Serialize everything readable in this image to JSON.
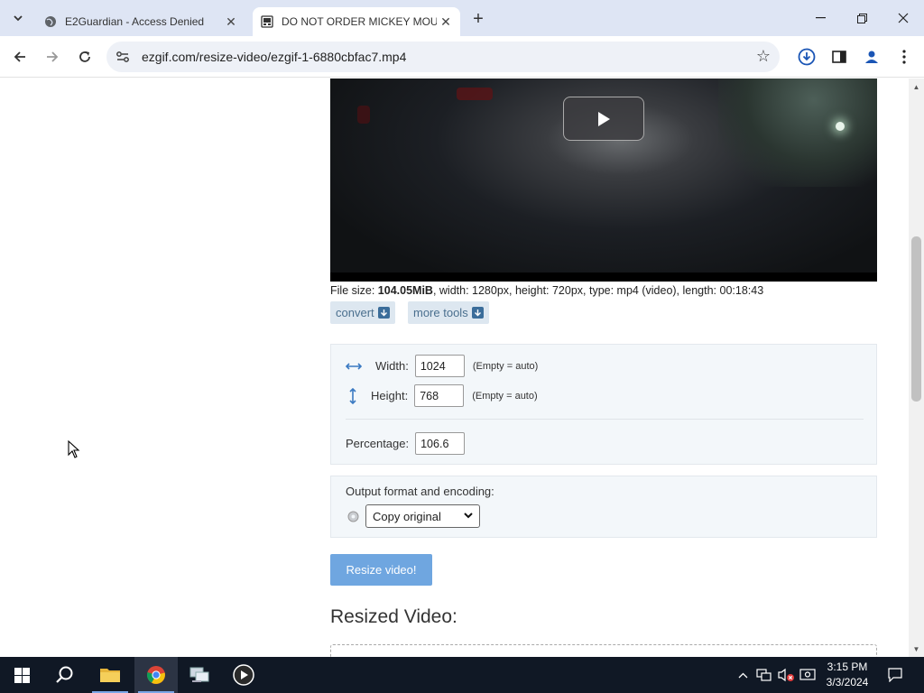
{
  "browser": {
    "tabs": [
      {
        "title": "E2Guardian - Access Denied",
        "active": false
      },
      {
        "title": "DO NOT ORDER MICKEY MOUS",
        "active": true
      }
    ],
    "url": "ezgif.com/resize-video/ezgif-1-6880cbfac7.mp4"
  },
  "video": {
    "file_size_label": "File size: ",
    "file_size": "104.05MiB",
    "details": ", width: 1280px, height: 720px, type: mp4 (video), length: 00:18:43"
  },
  "tools": {
    "convert": "convert",
    "more_tools": "more tools"
  },
  "resize": {
    "width_label": "Width:",
    "width_value": "1024",
    "height_label": "Height:",
    "height_value": "768",
    "empty_hint": "(Empty = auto)",
    "percentage_label": "Percentage:",
    "percentage_value": "106.6"
  },
  "output": {
    "label": "Output format and encoding:",
    "selected": "Copy original"
  },
  "submit_label": "Resize video!",
  "resized_heading": "Resized Video:",
  "taskbar": {
    "time": "3:15 PM",
    "date": "3/3/2024"
  }
}
